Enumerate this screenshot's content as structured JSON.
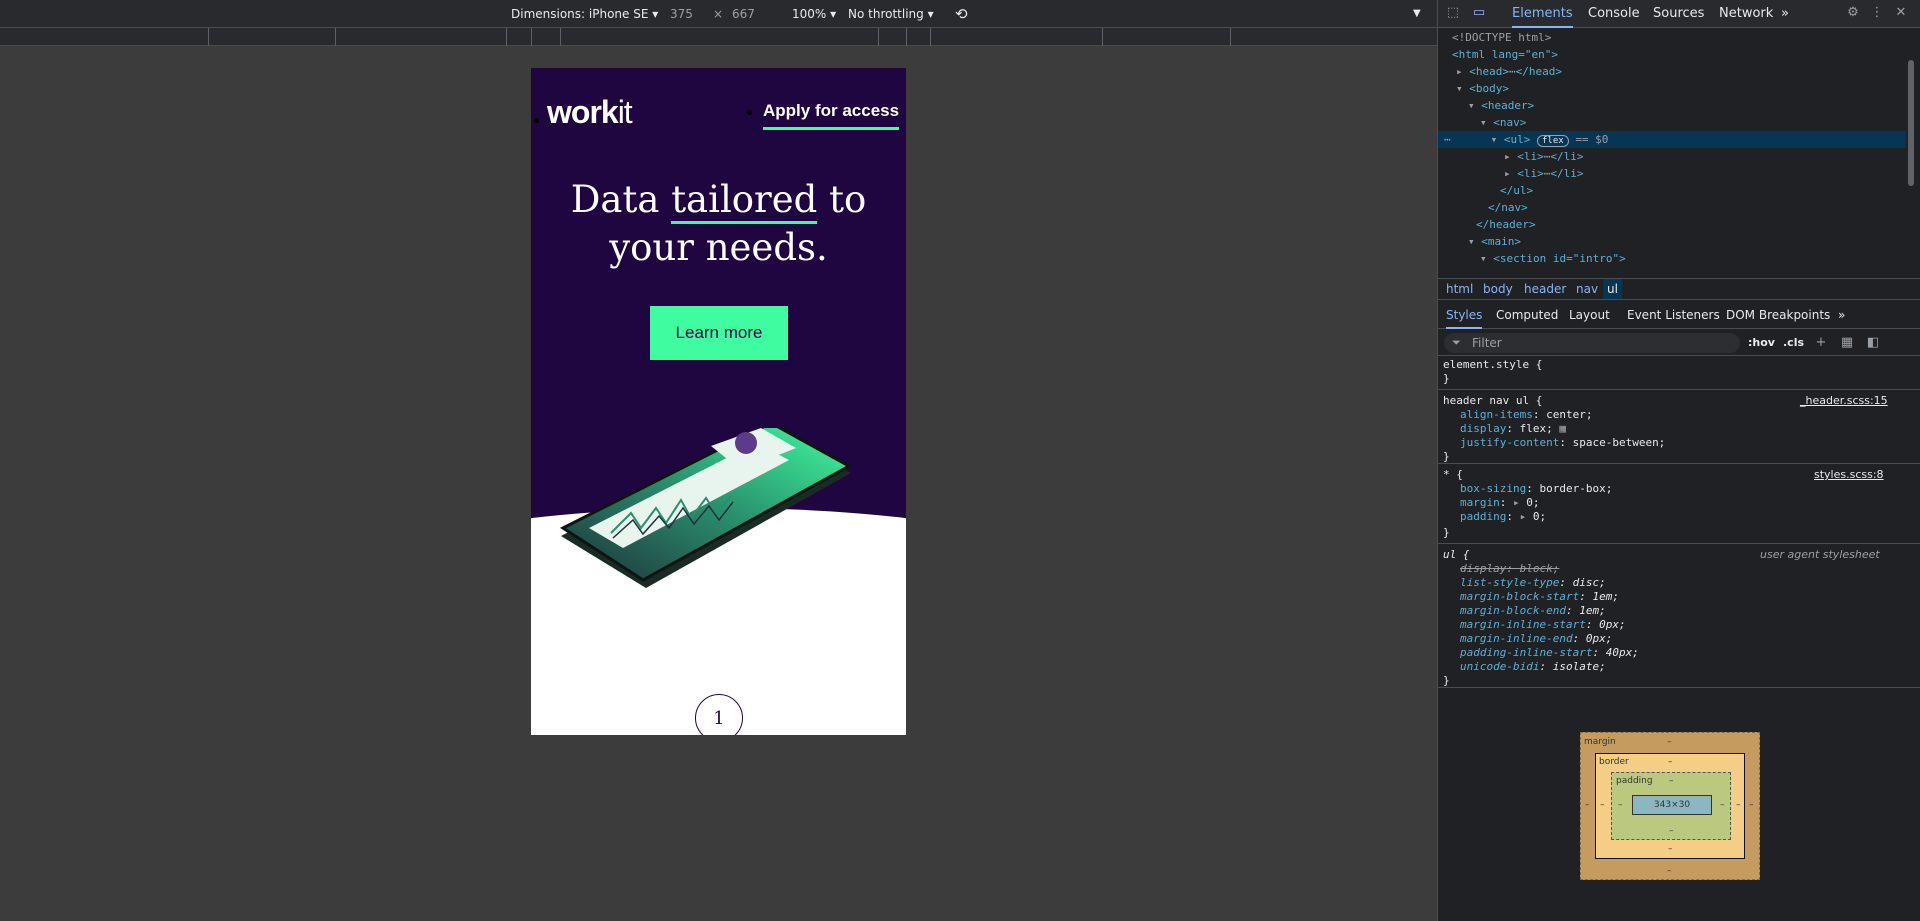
{
  "toolbar": {
    "dimensions_label": "Dimensions: iPhone SE",
    "width_value": "375",
    "times": "×",
    "height_value": "667",
    "zoom": "100%",
    "throttling": "No throttling"
  },
  "page": {
    "logo_bold": "work",
    "logo_light": "it",
    "apply_link": "Apply for access",
    "headline_part1": "Data ",
    "headline_underlined": "tailored",
    "headline_part2": " to",
    "headline_line2": "your needs.",
    "cta_label": "Learn more",
    "page_number": "1"
  },
  "colors": {
    "hero_bg": "#1f0640",
    "accent": "#3ffca1",
    "devtools_bg": "#202124"
  },
  "devtools": {
    "tabs": [
      "Elements",
      "Console",
      "Sources",
      "Network"
    ],
    "more_tabs": "»",
    "dom": {
      "doctype": "<!DOCTYPE html>",
      "html_open": "<html lang=\"en\">",
      "head": "<head>",
      "head_close": "</head>",
      "body": "<body>",
      "header": "<header>",
      "nav": "<nav>",
      "ul": "<ul>",
      "flex_badge": "flex",
      "eq_dollar": "== $0",
      "li1": "<li>",
      "li1_close": "</li>",
      "li2": "<li>",
      "li2_close": "</li>",
      "ul_close": "</ul>",
      "nav_close": "</nav>",
      "header_close": "</header>",
      "main": "<main>",
      "section": "<section id=\"intro\">"
    },
    "breadcrumb": [
      "html",
      "body",
      "header",
      "nav",
      "ul"
    ],
    "sub_tabs": [
      "Styles",
      "Computed",
      "Layout",
      "Event Listeners",
      "DOM Breakpoints"
    ],
    "filter_placeholder": "Filter",
    "hov": ":hov",
    "cls": ".cls",
    "rules": {
      "element_style": "element.style {",
      "close": "}",
      "r1_selector": "header nav ul {",
      "r1_source": "_header.scss:15",
      "r1_p1": "align-items",
      "r1_v1": "center;",
      "r1_p2": "display",
      "r1_v2": "flex;",
      "r1_p3": "justify-content",
      "r1_v3": "space-between;",
      "r2_selector": "* {",
      "r2_source": "styles.scss:8",
      "r2_p1": "box-sizing",
      "r2_v1": "border-box;",
      "r2_p2": "margin",
      "r2_v2": "0;",
      "r2_p3": "padding",
      "r2_v3": "0;",
      "r3_selector": "ul {",
      "r3_source": "user agent stylesheet",
      "r3_p1": "display",
      "r3_v1": "block;",
      "r3_p2": "list-style-type",
      "r3_v2": "disc;",
      "r3_p3": "margin-block-start",
      "r3_v3": "1em;",
      "r3_p4": "margin-block-end",
      "r3_v4": "1em;",
      "r3_p5": "margin-inline-start",
      "r3_v5": "0px;",
      "r3_p6": "margin-inline-end",
      "r3_v6": "0px;",
      "r3_p7": "padding-inline-start",
      "r3_v7": "40px;",
      "r3_p8": "unicode-bidi",
      "r3_v8": "isolate;"
    },
    "box_model": {
      "margin_label": "margin",
      "border_label": "border",
      "padding_label": "padding",
      "content_size": "343×30",
      "dash": "–"
    }
  }
}
